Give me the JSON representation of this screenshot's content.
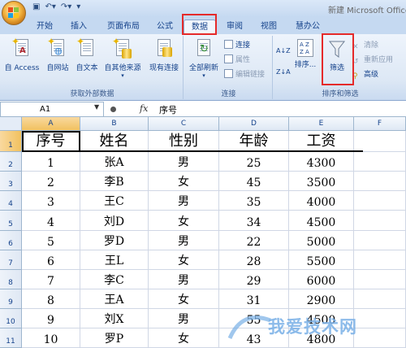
{
  "window": {
    "title": "新建 Microsoft Office"
  },
  "tabs": [
    {
      "label": "开始"
    },
    {
      "label": "插入"
    },
    {
      "label": "页面布局"
    },
    {
      "label": "公式"
    },
    {
      "label": "数据",
      "active": true
    },
    {
      "label": "审阅"
    },
    {
      "label": "视图"
    },
    {
      "label": "慧办公"
    }
  ],
  "ribbon": {
    "external": {
      "label": "获取外部数据",
      "access": "自 Access",
      "web": "自网站",
      "text": "自文本",
      "other": "自其他来源",
      "existing": "现有连接"
    },
    "connections": {
      "label": "连接",
      "refresh_all": "全部刷新",
      "conn": "连接",
      "props": "属性",
      "edit_links": "编辑链接"
    },
    "sort_filter": {
      "label": "排序和筛选",
      "sort": "排序...",
      "filter": "筛选",
      "clear": "清除",
      "reapply": "重新应用",
      "advanced": "高级",
      "az": "A↓Z",
      "za": "Z↓A"
    }
  },
  "formula_bar": {
    "name_box": "A1",
    "fx": "fx",
    "formula": "序号"
  },
  "columns": [
    "A",
    "B",
    "C",
    "D",
    "E",
    "F"
  ],
  "row_numbers": [
    "1",
    "2",
    "3",
    "4",
    "5",
    "6",
    "7",
    "8",
    "9",
    "10",
    "11"
  ],
  "table": {
    "headers": [
      "序号",
      "姓名",
      "性别",
      "年龄",
      "工资"
    ],
    "rows": [
      [
        "1",
        "张A",
        "男",
        "25",
        "4300"
      ],
      [
        "2",
        "李B",
        "女",
        "45",
        "3500"
      ],
      [
        "3",
        "王C",
        "男",
        "35",
        "4000"
      ],
      [
        "4",
        "刘D",
        "女",
        "34",
        "4500"
      ],
      [
        "5",
        "罗D",
        "男",
        "22",
        "5000"
      ],
      [
        "6",
        "王L",
        "女",
        "28",
        "5500"
      ],
      [
        "7",
        "李C",
        "男",
        "29",
        "6000"
      ],
      [
        "8",
        "王A",
        "女",
        "31",
        "2900"
      ],
      [
        "9",
        "刘X",
        "男",
        "55",
        "4500"
      ],
      [
        "10",
        "罗P",
        "女",
        "43",
        "4800"
      ]
    ]
  },
  "watermark": "我爱技术网",
  "colors": {
    "highlight_box": "#e52a2a",
    "ribbon_bg": "#dde8f5",
    "selected_header": "#f1c15f"
  }
}
